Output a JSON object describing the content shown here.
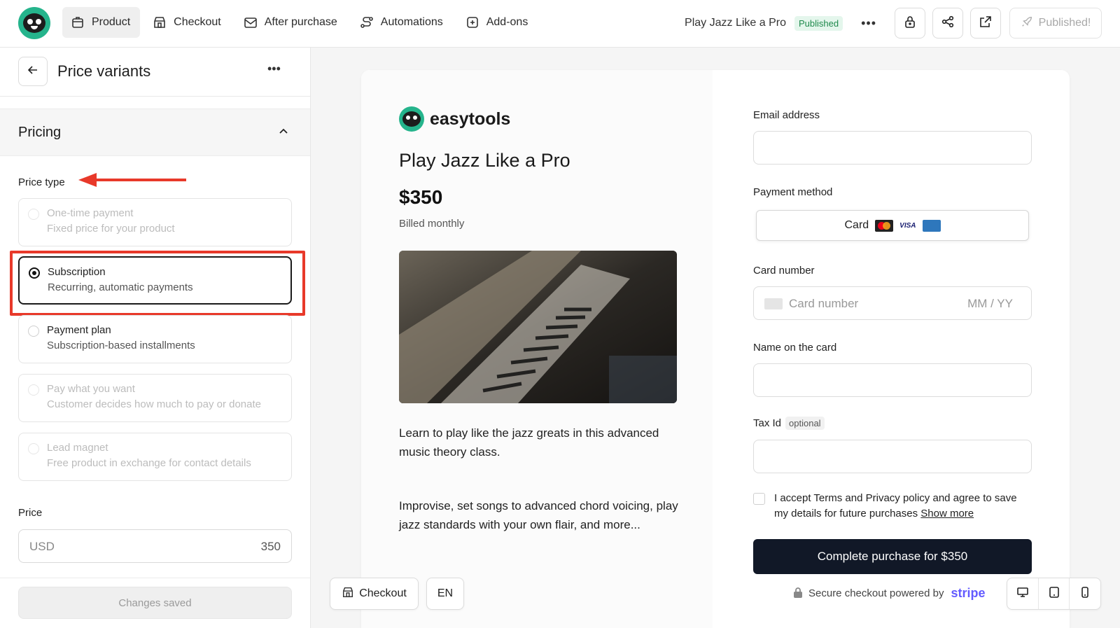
{
  "nav": {
    "items": [
      {
        "label": "Product",
        "icon": "box-icon",
        "active": true
      },
      {
        "label": "Checkout",
        "icon": "store-icon",
        "active": false
      },
      {
        "label": "After purchase",
        "icon": "mail-icon",
        "active": false
      },
      {
        "label": "Automations",
        "icon": "route-icon",
        "active": false
      },
      {
        "label": "Add-ons",
        "icon": "plus-square-icon",
        "active": false
      }
    ]
  },
  "header": {
    "product_title": "Play Jazz Like a Pro",
    "status_badge": "Published",
    "published_label": "Published!"
  },
  "left_panel": {
    "title": "Price variants",
    "section": "Pricing",
    "price_type_label": "Price type",
    "options": [
      {
        "title": "One-time payment",
        "desc": "Fixed price for your product",
        "state": "disabled"
      },
      {
        "title": "Subscription",
        "desc": "Recurring, automatic payments",
        "state": "selected"
      },
      {
        "title": "Payment plan",
        "desc": "Subscription-based installments",
        "state": "enabled"
      },
      {
        "title": "Pay what you want",
        "desc": "Customer decides how much to pay or donate",
        "state": "disabled"
      },
      {
        "title": "Lead magnet",
        "desc": "Free product in exchange for contact details",
        "state": "disabled"
      }
    ],
    "price_label": "Price",
    "price_currency": "USD",
    "price_value": "350",
    "saved_label": "Changes saved"
  },
  "preview": {
    "brand_name": "easytools",
    "title": "Play Jazz Like a Pro",
    "price": "$350",
    "billing": "Billed monthly",
    "description_1": "Learn to play like the jazz greats in this advanced music theory class.",
    "description_2": "Improvise, set songs to advanced chord voicing, play jazz standards with your own flair, and more...",
    "form": {
      "email_label": "Email address",
      "payment_method_label": "Payment method",
      "payment_method_value": "Card",
      "card_number_label": "Card number",
      "card_number_placeholder": "Card number",
      "expiry_placeholder": "MM / YY",
      "name_label": "Name on the card",
      "tax_label": "Tax Id",
      "tax_optional": "optional",
      "terms_text": "I accept Terms and Privacy policy and agree to save my details for future purchases",
      "show_more": "Show more",
      "submit_label": "Complete purchase for $350",
      "secure_text": "Secure checkout powered by",
      "stripe": "stripe",
      "visa": "VISA"
    }
  },
  "floating": {
    "checkout_label": "Checkout",
    "language": "EN"
  },
  "colors": {
    "brand_green": "#25b48c",
    "annotation_red": "#e8392a",
    "submit_bg": "#111827",
    "stripe": "#635bff"
  }
}
